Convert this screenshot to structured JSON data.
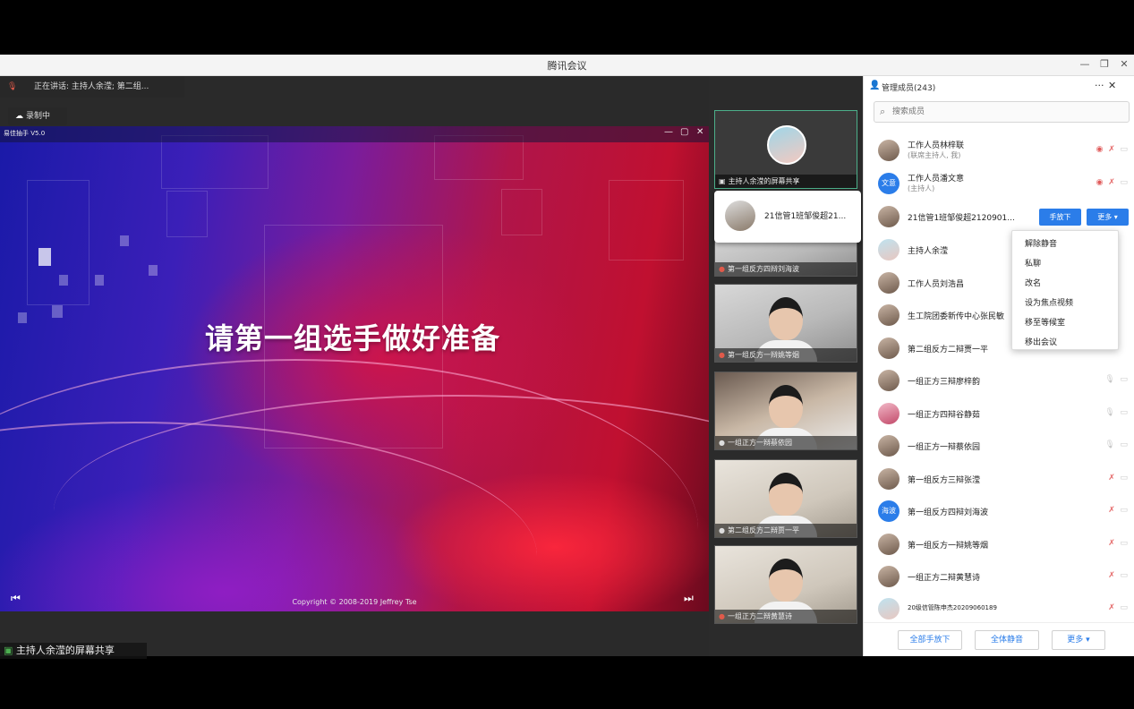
{
  "window": {
    "title": "腾讯会议",
    "minimize": "—",
    "maximize": "❐",
    "close": "✕"
  },
  "speaking": {
    "mic_icon": "mic-muted-icon",
    "text": "正在讲话: 主持人余滢; 第二组..."
  },
  "recording": {
    "label": "录制中",
    "icon": "cloud-record-icon"
  },
  "slide": {
    "app_name": "易佳抽手 V5.0",
    "controls": [
      "—",
      "▢",
      "✕"
    ],
    "heading": "请第一组选手做好准备",
    "copyright": "Copyright © 2008-2019 Jeffrey Tse",
    "prev": "⏮",
    "next": "⏭"
  },
  "share_label": "主持人余滢的屏幕共享",
  "video_tiles": [
    {
      "label": "主持人余滢的屏幕共享",
      "active": true
    },
    {
      "label": "第一组反方四辩刘海波"
    },
    {
      "label": "第一组反方一辩姚等烟"
    },
    {
      "label": "一组正方一辩蔡依园"
    },
    {
      "label": "第二组反方二辩贾一平"
    },
    {
      "label": "一组正方二辩黄慧诗"
    }
  ],
  "popup_card": {
    "name": "21信管1班邹俊超21..."
  },
  "panel": {
    "title": "管理成员(243)",
    "more": "···",
    "close": "✕",
    "search_placeholder": "搜索成员",
    "members": [
      {
        "name": "工作人员林梓联",
        "role": "(联席主持人, 我)",
        "avatar": ""
      },
      {
        "name": "工作人员潘文意",
        "role": "(主持人)",
        "avatar": "文意"
      },
      {
        "name": "21信管1班邹俊超2120901...",
        "role": "",
        "avatar": ""
      },
      {
        "name": "主持人余滢",
        "role": "",
        "avatar": ""
      },
      {
        "name": "工作人员刘浩昌",
        "role": "",
        "avatar": ""
      },
      {
        "name": "生工院团委新传中心张民敏",
        "role": "",
        "avatar": ""
      },
      {
        "name": "第二组反方二辩贾一平",
        "role": "",
        "avatar": ""
      },
      {
        "name": "一组正方三辩廖梓韵",
        "role": "",
        "avatar": ""
      },
      {
        "name": "一组正方四辩谷静茹",
        "role": "",
        "avatar": ""
      },
      {
        "name": "一组正方一辩蔡依园",
        "role": "",
        "avatar": ""
      },
      {
        "name": "第一组反方三辩张滢",
        "role": "",
        "avatar": ""
      },
      {
        "name": "第一组反方四辩刘海波",
        "role": "",
        "avatar": "海波"
      },
      {
        "name": "第一组反方一辩姚等烟",
        "role": "",
        "avatar": ""
      },
      {
        "name": "一组正方二辩黄慧诗",
        "role": "",
        "avatar": ""
      },
      {
        "name": "20级信管陈申杰20209060189",
        "role": "",
        "avatar": ""
      }
    ],
    "hand_down_label": "手放下",
    "more_label": "更多 ▾",
    "menu_items": [
      "解除静音",
      "私聊",
      "改名",
      "设为焦点视频",
      "移至等候室",
      "移出会议"
    ],
    "footer": {
      "all_hands_down": "全部手放下",
      "mute_all": "全体静音",
      "more": "更多 ▾"
    }
  },
  "colors": {
    "accent": "#2b7de9",
    "muted": "#e56a6a",
    "active_border": "#4caf8a"
  }
}
